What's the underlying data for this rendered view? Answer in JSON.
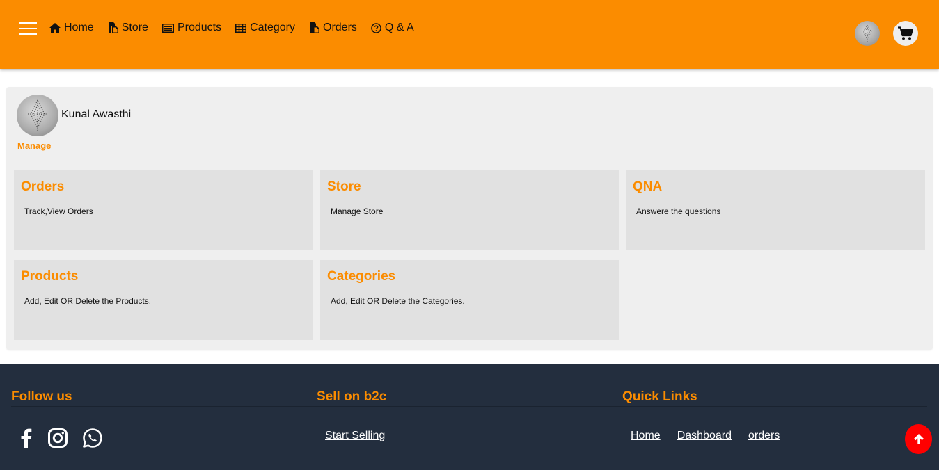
{
  "header": {
    "nav": [
      {
        "label": "Home",
        "icon": "home-icon"
      },
      {
        "label": "Store",
        "icon": "store-icon"
      },
      {
        "label": "Products",
        "icon": "products-icon"
      },
      {
        "label": "Category",
        "icon": "category-icon"
      },
      {
        "label": "Orders",
        "icon": "orders-icon"
      },
      {
        "label": "Q & A",
        "icon": "question-circle-icon"
      }
    ],
    "cart_icon": "shopping-cart-icon",
    "colors": {
      "bar": "#fb8c00",
      "text": "#111111"
    }
  },
  "profile": {
    "name": "Kunal Awasthi",
    "manage_label": "Manage"
  },
  "cards": [
    {
      "title": "Orders",
      "description": "Track,View Orders"
    },
    {
      "title": "Store",
      "description": "Manage Store"
    },
    {
      "title": "QNA",
      "description": "Answere the questions"
    },
    {
      "title": "Products",
      "description": "Add, Edit OR Delete the Products."
    },
    {
      "title": "Categories",
      "description": "Add, Edit OR Delete the Categories."
    }
  ],
  "footer": {
    "follow_heading": "Follow us",
    "sell_heading": "Sell on b2c",
    "quick_heading": "Quick Links",
    "start_selling": "Start Selling",
    "quick_links": [
      "Home",
      "Dashboard",
      "orders"
    ],
    "social_icons": [
      "facebook-icon",
      "instagram-icon",
      "whatsapp-icon"
    ],
    "colors": {
      "background": "#232e3e",
      "heading": "#fb8c00"
    }
  },
  "scroll_top_icon": "arrow-up-icon",
  "colors": {
    "accent": "#fb8c00",
    "scroll_top": "#ff0000"
  }
}
